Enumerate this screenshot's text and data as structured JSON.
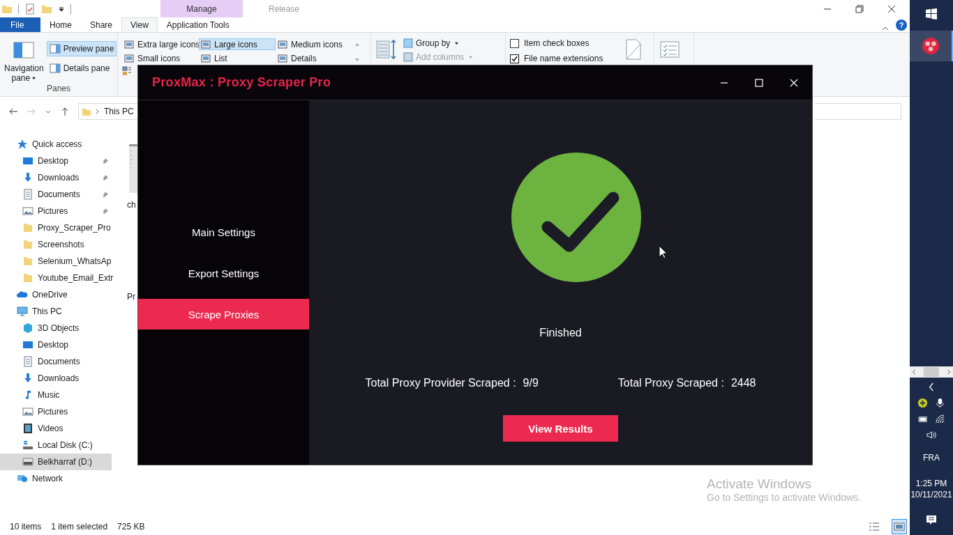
{
  "explorer": {
    "contextual_tabs": [
      {
        "label": "Manage",
        "active": true
      },
      {
        "label": "Release",
        "active": false
      }
    ],
    "help": "?",
    "ribbon_tabs": [
      {
        "label": "File",
        "kind": "menu",
        "selected": false
      },
      {
        "label": "Home",
        "kind": "tab",
        "selected": false
      },
      {
        "label": "Share",
        "kind": "tab",
        "selected": false
      },
      {
        "label": "View",
        "kind": "tab",
        "selected": true
      },
      {
        "label": "Application Tools",
        "kind": "tab",
        "selected": false
      }
    ],
    "panes": {
      "label": "Panes",
      "navigation_pane": "Navigation pane",
      "buttons": [
        {
          "label": "Preview pane",
          "selected": true
        },
        {
          "label": "Details pane",
          "selected": false
        }
      ]
    },
    "layout_options": [
      {
        "label": "Extra large icons",
        "selected": false
      },
      {
        "label": "Large icons",
        "selected": true
      },
      {
        "label": "Medium icons",
        "selected": false
      },
      {
        "label": "Small icons",
        "selected": false
      },
      {
        "label": "List",
        "selected": false
      },
      {
        "label": "Details",
        "selected": false
      }
    ],
    "current_view": [
      {
        "label": "Group by",
        "disabled": false
      },
      {
        "label": "Add columns",
        "disabled": true
      }
    ],
    "show_hide": [
      {
        "label": "Item check boxes",
        "checked": false
      },
      {
        "label": "File name extensions",
        "checked": true
      }
    ],
    "address": {
      "path": "This PC"
    },
    "nav": [
      {
        "label": "Quick access",
        "kind": "star",
        "selected": false,
        "children": [
          {
            "label": "Desktop",
            "kind": "desktop",
            "pinned": true,
            "selected": false
          },
          {
            "label": "Downloads",
            "kind": "download",
            "pinned": true,
            "selected": false
          },
          {
            "label": "Documents",
            "kind": "document",
            "pinned": true,
            "selected": false
          },
          {
            "label": "Pictures",
            "kind": "pictures",
            "pinned": true,
            "selected": false
          },
          {
            "label": "Proxy_Scraper_Pro",
            "kind": "folder",
            "pinned": false,
            "selected": false
          },
          {
            "label": "Screenshots",
            "kind": "folder",
            "pinned": false,
            "selected": false
          },
          {
            "label": "Selenium_WhatsAp",
            "kind": "folder",
            "pinned": false,
            "selected": false
          },
          {
            "label": "Youtube_Email_Extr",
            "kind": "folder",
            "pinned": false,
            "selected": false
          }
        ]
      },
      {
        "label": "OneDrive",
        "kind": "cloud",
        "selected": false
      },
      {
        "label": "This PC",
        "kind": "pc",
        "selected": false,
        "children": [
          {
            "label": "3D Objects",
            "kind": "cube",
            "pinned": false,
            "selected": false
          },
          {
            "label": "Desktop",
            "kind": "desktop",
            "pinned": false,
            "selected": false
          },
          {
            "label": "Documents",
            "kind": "document",
            "pinned": false,
            "selected": false
          },
          {
            "label": "Downloads",
            "kind": "download",
            "pinned": false,
            "selected": false
          },
          {
            "label": "Music",
            "kind": "music",
            "pinned": false,
            "selected": false
          },
          {
            "label": "Pictures",
            "kind": "pictures",
            "pinned": false,
            "selected": false
          },
          {
            "label": "Videos",
            "kind": "video",
            "pinned": false,
            "selected": false
          },
          {
            "label": "Local Disk (C:)",
            "kind": "disk",
            "pinned": false,
            "selected": false
          },
          {
            "label": "Belkharraf (D:)",
            "kind": "drive",
            "pinned": false,
            "selected": true
          }
        ]
      },
      {
        "label": "Network",
        "kind": "network",
        "selected": false
      }
    ],
    "files": [
      {
        "name": "ch"
      },
      {
        "name": "Pr"
      }
    ],
    "status": {
      "count": "10 items",
      "selection": "1 item selected",
      "size": "725 KB"
    },
    "view_buttons": [
      {
        "kind": "details",
        "selected": false
      },
      {
        "kind": "large-icons",
        "selected": true
      }
    ],
    "activation": {
      "title": "Activate Windows",
      "subtitle": "Go to Settings to activate Windows."
    }
  },
  "app": {
    "title": "ProxMax : Proxy Scraper Pro",
    "menu": [
      {
        "label": "Main Settings",
        "selected": false
      },
      {
        "label": "Export Settings",
        "selected": false
      },
      {
        "label": "Scrape Proxies",
        "selected": true
      }
    ],
    "status": "Finished",
    "stats": [
      {
        "label": "Total Proxy Provider Scraped :",
        "value": "9/9"
      },
      {
        "label": "Total Proxy Scraped :",
        "value": "2448"
      }
    ],
    "button": "View Results"
  },
  "taskbar": {
    "language": "FRA",
    "time": "1:25 PM",
    "date": "10/11/2021"
  }
}
